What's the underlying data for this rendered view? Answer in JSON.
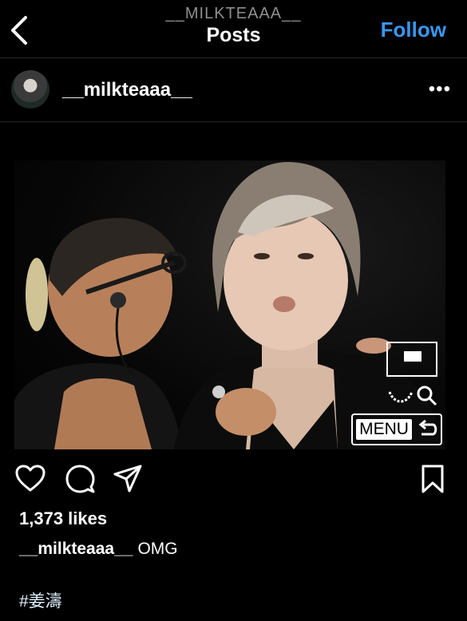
{
  "header": {
    "account": "__MILKTEAAA__",
    "title": "Posts",
    "follow_label": "Follow"
  },
  "post": {
    "username": "__milkteaaa__",
    "more_label": "•••",
    "likes": "1,373 likes",
    "caption_username": "__milkteaaa__",
    "caption_text": "OMG",
    "hashtag": "#姜濤",
    "overlay_menu_label": "MENU"
  },
  "icons": [
    "back-chevron-icon",
    "heart-icon",
    "comment-icon",
    "share-icon",
    "bookmark-icon",
    "more-icon"
  ],
  "colors": {
    "background": "#000000",
    "accent": "#3797f0",
    "muted": "#8e8e8e"
  }
}
